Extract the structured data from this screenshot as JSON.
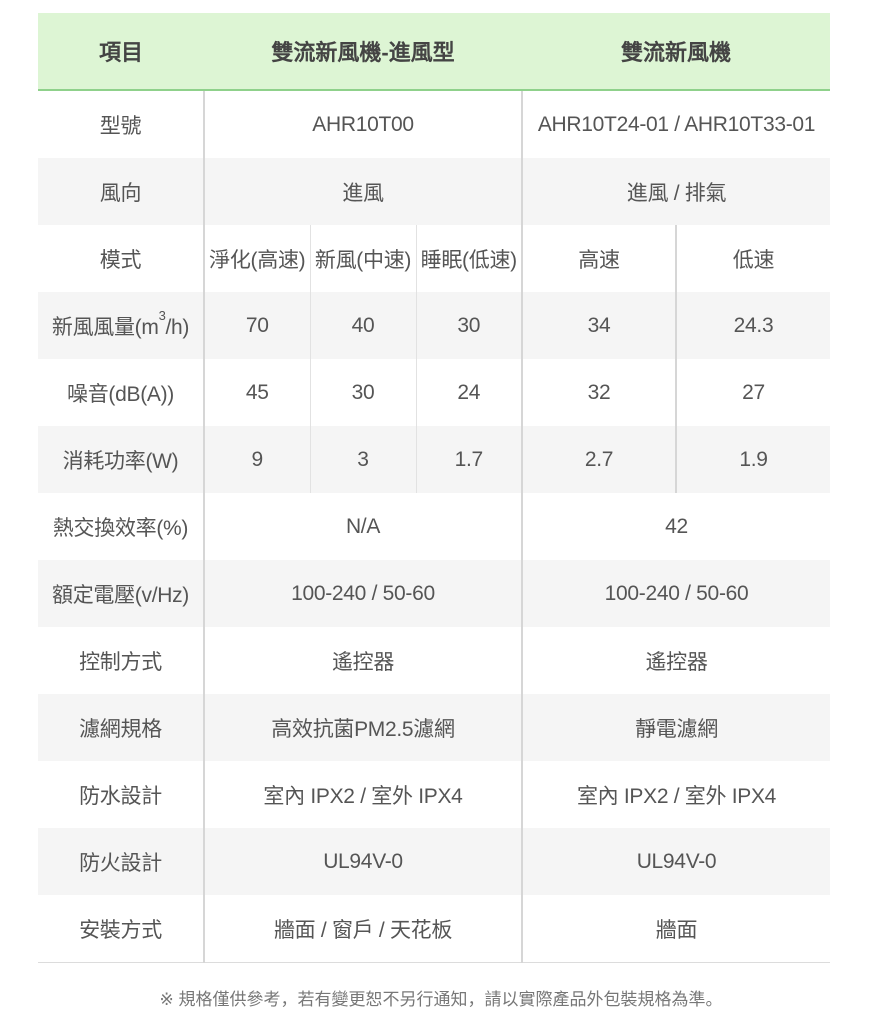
{
  "header": {
    "item": "項目",
    "model_a": "雙流新風機-進風型",
    "model_b": "雙流新風機"
  },
  "rows": {
    "model_no": {
      "label": "型號",
      "a": "AHR10T00",
      "b": "AHR10T24-01 / AHR10T33-01"
    },
    "airflow_dir": {
      "label": "風向",
      "a": "進風",
      "b": "進風 / 排氣"
    },
    "mode": {
      "label": "模式",
      "a": [
        "淨化(高速)",
        "新風(中速)",
        "睡眠(低速)"
      ],
      "b": [
        "高速",
        "低速"
      ]
    },
    "air_volume": {
      "label_prefix": "新風風量(m",
      "label_sup": "3",
      "label_suffix": "/h)",
      "a": [
        "70",
        "40",
        "30"
      ],
      "b": [
        "34",
        "24.3"
      ]
    },
    "noise": {
      "label": "噪音(dB(A))",
      "a": [
        "45",
        "30",
        "24"
      ],
      "b": [
        "32",
        "27"
      ]
    },
    "power": {
      "label": "消耗功率(W)",
      "a": [
        "9",
        "3",
        "1.7"
      ],
      "b": [
        "2.7",
        "1.9"
      ]
    },
    "heat_exchange": {
      "label": "熱交換效率(%)",
      "a": "N/A",
      "b": "42"
    },
    "voltage": {
      "label": "額定電壓(v/Hz)",
      "a": "100-240 / 50-60",
      "b": "100-240 / 50-60"
    },
    "control": {
      "label": "控制方式",
      "a": "遙控器",
      "b": "遙控器"
    },
    "filter": {
      "label": "濾網規格",
      "a": "高效抗菌PM2.5濾網",
      "b": "靜電濾網"
    },
    "waterproof": {
      "label": "防水設計",
      "a": "室內 IPX2 / 室外 IPX4",
      "b": "室內 IPX2 / 室外 IPX4"
    },
    "fireproof": {
      "label": "防火設計",
      "a": "UL94V-0",
      "b": "UL94V-0"
    },
    "install": {
      "label": "安裝方式",
      "a": "牆面 / 窗戶 / 天花板",
      "b": "牆面"
    }
  },
  "footnote": "※ 規格僅供參考，若有變更恕不另行通知，請以實際產品外包裝規格為準。",
  "colors": {
    "header_bg": "#ddf5d4",
    "header_rule": "#8fd18b",
    "stripe_bg": "#f5f5f5",
    "text": "#555555"
  }
}
